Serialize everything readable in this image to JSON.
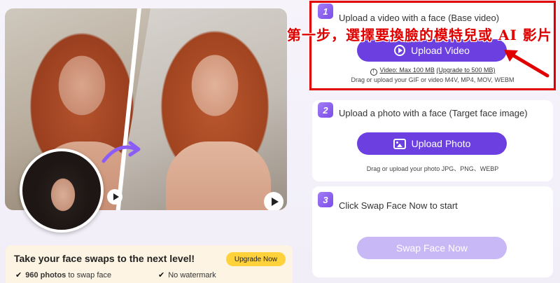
{
  "preview": {
    "icons": [
      "play-icon",
      "swap-arrow-icon"
    ]
  },
  "upgrade": {
    "title": "Take your face swaps to the next level!",
    "button": "Upgrade Now",
    "feature1_bold": "960 photos",
    "feature1_rest": "to swap face",
    "feature2": "No watermark",
    "check": "✔"
  },
  "steps": [
    {
      "number": "1",
      "title": "Upload a video with a face (Base video)",
      "button": "Upload Video",
      "limit_prefix": "Video: Max 100 MB",
      "limit_link": "(Upgrade to 500 MB)",
      "hint": "Drag or upload your GIF or video M4V, MP4, MOV, WEBM"
    },
    {
      "number": "2",
      "title": "Upload a photo with a face (Target face image)",
      "button": "Upload Photo",
      "hint": "Drag or upload your photo JPG、PNG、WEBP"
    },
    {
      "number": "3",
      "title": "Click Swap Face Now to start",
      "button": "Swap Face Now"
    }
  ],
  "annotation": {
    "text": "第一步，選擇要換臉的模特兒或 AI 影片",
    "color": "#e00000"
  },
  "colors": {
    "primary": "#6b3fe0",
    "primary_disabled": "#c9b8f6",
    "upgrade_button": "#ffd23b"
  }
}
